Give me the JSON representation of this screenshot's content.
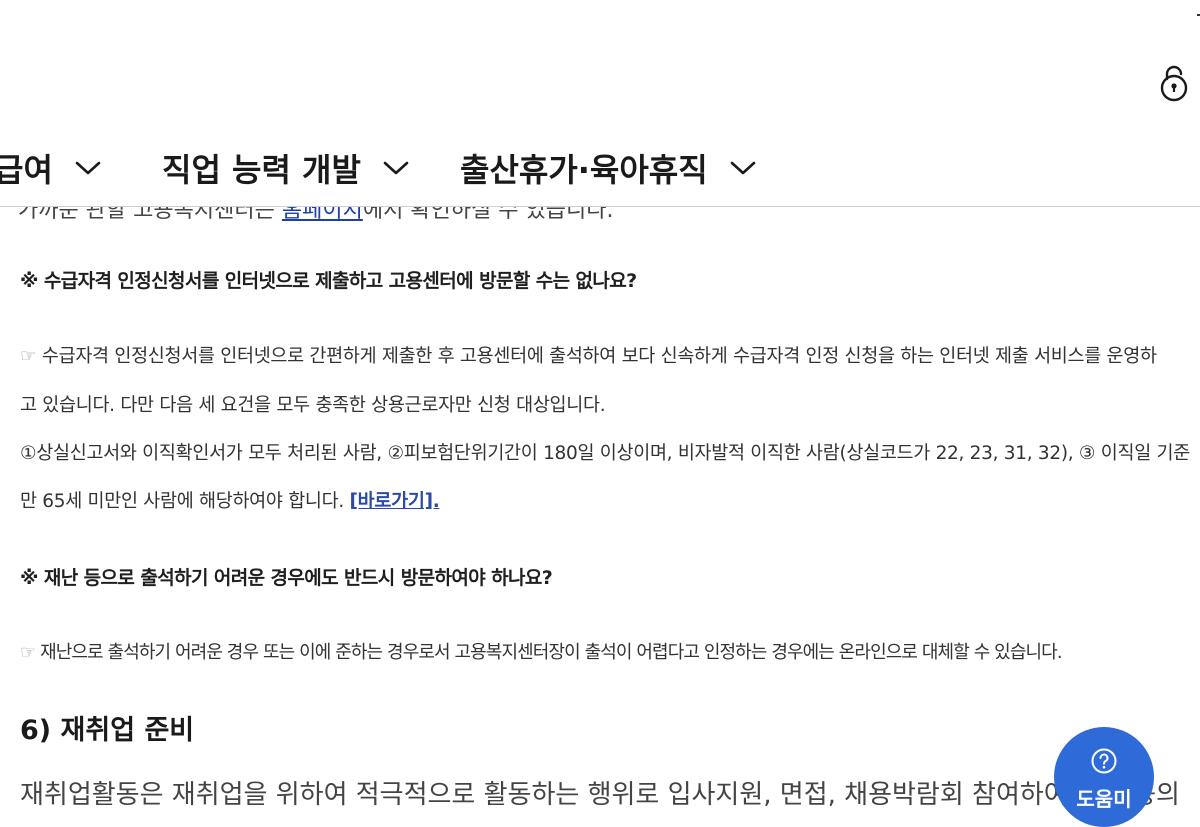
{
  "nav": {
    "items": [
      {
        "label": "급여"
      },
      {
        "label": "직업 능력 개발"
      },
      {
        "label": "출산휴가·육아휴직"
      }
    ]
  },
  "content": {
    "cut_line_before": "가까운 관할 고용복지센터는 ",
    "cut_line_link": "홈페이지",
    "cut_line_after": "에서 확인하실 수 있습니다.",
    "faq1": {
      "question": "※ 수급자격 인정신청서를 인터넷으로 제출하고 고용센터에 방문할 수는 없나요?",
      "answer_line1": "수급자격 인정신청서를 인터넷으로 간편하게 제출한 후 고용센터에 출석하여 보다 신속하게 수급자격 인정 신청을 하는 인터넷 제출 서비스를 운영하",
      "answer_line2": "고 있습니다. 다만 다음 세 요건을 모두 충족한 상용근로자만 신청 대상입니다.",
      "answer_line3": "①상실신고서와 이직확인서가 모두 처리된 사람, ②피보험단위기간이 180일 이상이며, 비자발적 이직한 사람(상실코드가 22, 23, 31, 32), ③ 이직일 기준",
      "answer_line4": "만 65세 미만인 사람에 해당하여야 합니다. ",
      "link": "[바로가기]."
    },
    "faq2": {
      "question": "※ 재난 등으로 출석하기 어려운 경우에도 반드시 방문하여야 하나요?",
      "answer": "재난으로 출석하기 어려운 경우 또는 이에 준하는 경우로서 고용복지센터장이 출석이 어렵다고 인정하는 경우에는 온라인으로 대체할 수 있습니다."
    },
    "section_title": "6) 재취업 준비",
    "bottom_cut": "재취업활동은 재취업을 위하여 적극적으로 활동하는 행위로 입사지원, 면접, 채용박람회 참여하여 면접 등의"
  },
  "hand_glyph": "☞",
  "help": {
    "label": "도움미"
  },
  "icons": {
    "lock": "unlock-icon",
    "chevron": "chevron-down-icon",
    "help": "question-circle-icon"
  },
  "colors": {
    "link": "#1c3fa8",
    "help_button": "#2f6bd8"
  }
}
